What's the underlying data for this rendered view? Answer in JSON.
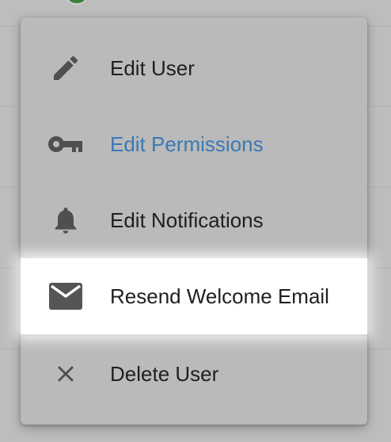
{
  "colors": {
    "overlay_background": "#bdbdbd",
    "menu_background": "#bababa",
    "active_text": "#3b78b4",
    "highlight_background": "#ffffff",
    "icon_color": "#4f4f4f",
    "text_color": "#1f1f1f"
  },
  "menu": {
    "items": [
      {
        "label": "Edit User",
        "icon": "pencil-icon",
        "active": false,
        "highlighted": false
      },
      {
        "label": "Edit Permissions",
        "icon": "key-icon",
        "active": true,
        "highlighted": false
      },
      {
        "label": "Edit Notifications",
        "icon": "bell-icon",
        "active": false,
        "highlighted": false
      },
      {
        "label": "Resend Welcome Email",
        "icon": "envelope-icon",
        "active": false,
        "highlighted": true
      },
      {
        "label": "Delete User",
        "icon": "close-icon",
        "active": false,
        "highlighted": false
      }
    ]
  }
}
